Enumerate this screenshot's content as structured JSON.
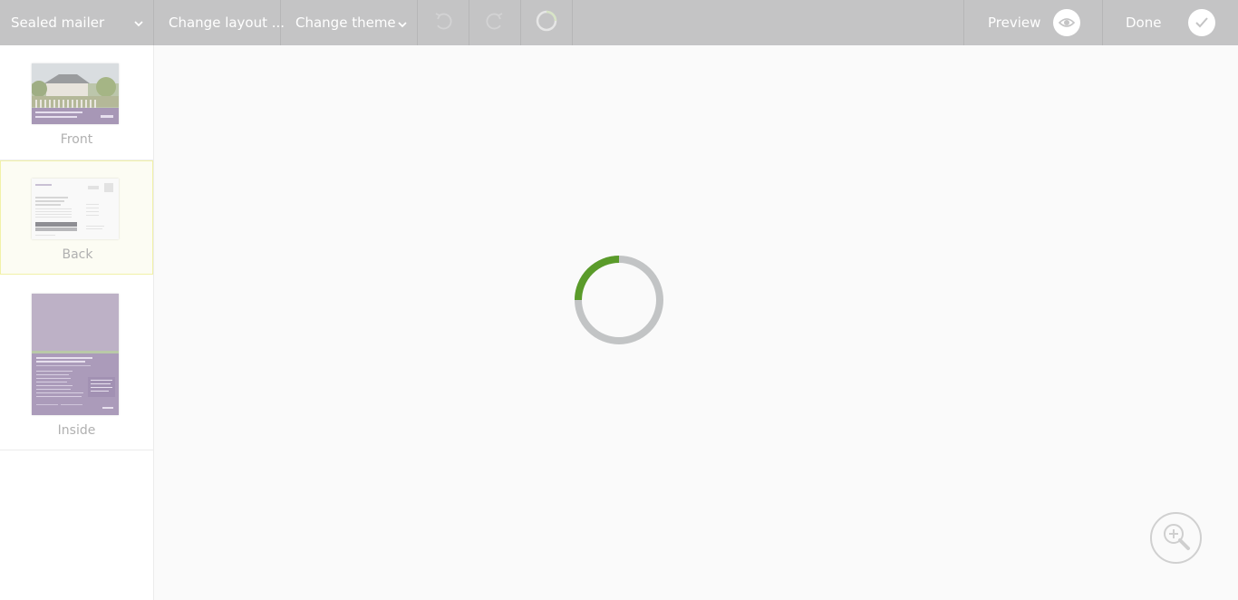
{
  "toolbar": {
    "product_select": "Sealed mailer",
    "change_layout": "Change layout ...",
    "change_theme": "Change theme",
    "preview": "Preview",
    "done": "Done"
  },
  "pages": [
    {
      "label": "Front"
    },
    {
      "label": "Back"
    },
    {
      "label": "Inside"
    }
  ],
  "loading": {
    "progress": 0.25
  },
  "colors": {
    "toolbar_bg": "#c4c4c5",
    "spinner_accent": "#5a9b2a",
    "spinner_track": "#c2c4c5",
    "selected_page_border": "#f1f1a8"
  }
}
